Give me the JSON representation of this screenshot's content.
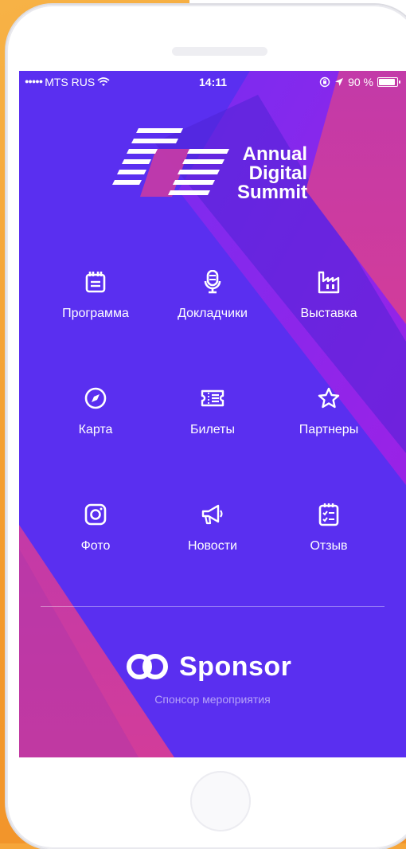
{
  "status_bar": {
    "carrier": "MTS RUS",
    "time": "14:11",
    "battery": "90 %",
    "battery_level": 0.9
  },
  "event": {
    "title_line1": "Annual",
    "title_line2": "Digital",
    "title_line3": "Summit"
  },
  "menu": [
    {
      "label": "Программа",
      "icon": "calendar-icon"
    },
    {
      "label": "Докладчики",
      "icon": "microphone-icon"
    },
    {
      "label": "Выставка",
      "icon": "factory-icon"
    },
    {
      "label": "Карта",
      "icon": "compass-icon"
    },
    {
      "label": "Билеты",
      "icon": "ticket-icon"
    },
    {
      "label": "Партнеры",
      "icon": "star-icon"
    },
    {
      "label": "Фото",
      "icon": "instagram-icon"
    },
    {
      "label": "Новости",
      "icon": "megaphone-icon"
    },
    {
      "label": "Отзыв",
      "icon": "checklist-icon"
    }
  ],
  "sponsor": {
    "name": "Sponsor",
    "subtitle": "Спонсор мероприятия"
  },
  "colors": {
    "background": "#5a2ff0",
    "accent_pink": "#c53aa3",
    "accent_purple": "#8a26e8",
    "frame_orange": "#f39a2c"
  }
}
